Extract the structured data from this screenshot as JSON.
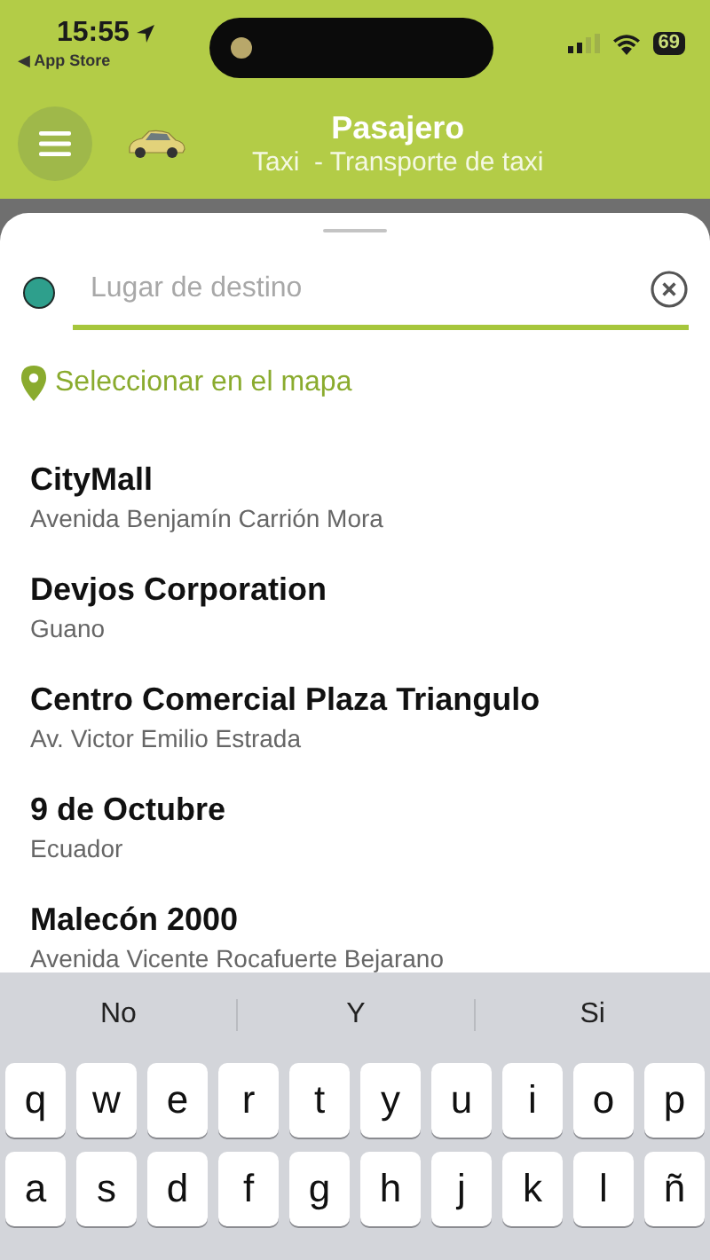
{
  "status_bar": {
    "time": "15:55",
    "back_link": "◀ App Store",
    "battery": "69"
  },
  "header": {
    "title": "Pasajero",
    "subtitle": "Taxi  - Transporte de taxi"
  },
  "search": {
    "placeholder": "Lugar de destino"
  },
  "map_link": "Seleccionar en el mapa",
  "places": [
    {
      "name": "CityMall",
      "address": "Avenida Benjamín Carrión Mora"
    },
    {
      "name": "Devjos Corporation",
      "address": "Guano"
    },
    {
      "name": "Centro Comercial Plaza Triangulo",
      "address": "Av. Victor Emilio Estrada"
    },
    {
      "name": "9 de Octubre",
      "address": "Ecuador"
    },
    {
      "name": "Malecón 2000",
      "address": "Avenida Vicente Rocafuerte Bejarano"
    }
  ],
  "keyboard": {
    "suggestions": [
      "No",
      "Y",
      "Si"
    ],
    "rows": [
      [
        "q",
        "w",
        "e",
        "r",
        "t",
        "y",
        "u",
        "i",
        "o",
        "p"
      ],
      [
        "a",
        "s",
        "d",
        "f",
        "g",
        "h",
        "j",
        "k",
        "l",
        "ñ"
      ]
    ]
  }
}
